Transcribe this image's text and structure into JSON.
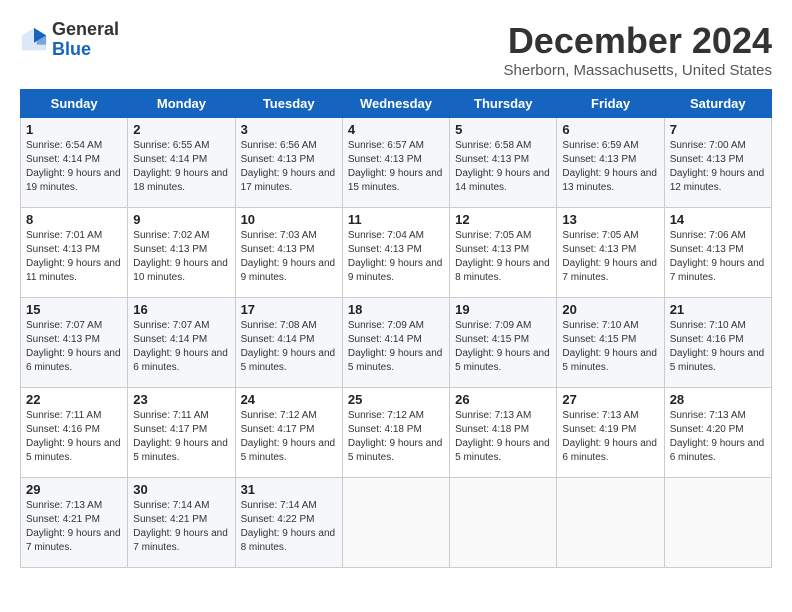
{
  "header": {
    "logo_general": "General",
    "logo_blue": "Blue",
    "title": "December 2024",
    "subtitle": "Sherborn, Massachusetts, United States"
  },
  "weekdays": [
    "Sunday",
    "Monday",
    "Tuesday",
    "Wednesday",
    "Thursday",
    "Friday",
    "Saturday"
  ],
  "weeks": [
    [
      {
        "day": "1",
        "sunrise": "Sunrise: 6:54 AM",
        "sunset": "Sunset: 4:14 PM",
        "daylight": "Daylight: 9 hours and 19 minutes."
      },
      {
        "day": "2",
        "sunrise": "Sunrise: 6:55 AM",
        "sunset": "Sunset: 4:14 PM",
        "daylight": "Daylight: 9 hours and 18 minutes."
      },
      {
        "day": "3",
        "sunrise": "Sunrise: 6:56 AM",
        "sunset": "Sunset: 4:13 PM",
        "daylight": "Daylight: 9 hours and 17 minutes."
      },
      {
        "day": "4",
        "sunrise": "Sunrise: 6:57 AM",
        "sunset": "Sunset: 4:13 PM",
        "daylight": "Daylight: 9 hours and 15 minutes."
      },
      {
        "day": "5",
        "sunrise": "Sunrise: 6:58 AM",
        "sunset": "Sunset: 4:13 PM",
        "daylight": "Daylight: 9 hours and 14 minutes."
      },
      {
        "day": "6",
        "sunrise": "Sunrise: 6:59 AM",
        "sunset": "Sunset: 4:13 PM",
        "daylight": "Daylight: 9 hours and 13 minutes."
      },
      {
        "day": "7",
        "sunrise": "Sunrise: 7:00 AM",
        "sunset": "Sunset: 4:13 PM",
        "daylight": "Daylight: 9 hours and 12 minutes."
      }
    ],
    [
      {
        "day": "8",
        "sunrise": "Sunrise: 7:01 AM",
        "sunset": "Sunset: 4:13 PM",
        "daylight": "Daylight: 9 hours and 11 minutes."
      },
      {
        "day": "9",
        "sunrise": "Sunrise: 7:02 AM",
        "sunset": "Sunset: 4:13 PM",
        "daylight": "Daylight: 9 hours and 10 minutes."
      },
      {
        "day": "10",
        "sunrise": "Sunrise: 7:03 AM",
        "sunset": "Sunset: 4:13 PM",
        "daylight": "Daylight: 9 hours and 9 minutes."
      },
      {
        "day": "11",
        "sunrise": "Sunrise: 7:04 AM",
        "sunset": "Sunset: 4:13 PM",
        "daylight": "Daylight: 9 hours and 9 minutes."
      },
      {
        "day": "12",
        "sunrise": "Sunrise: 7:05 AM",
        "sunset": "Sunset: 4:13 PM",
        "daylight": "Daylight: 9 hours and 8 minutes."
      },
      {
        "day": "13",
        "sunrise": "Sunrise: 7:05 AM",
        "sunset": "Sunset: 4:13 PM",
        "daylight": "Daylight: 9 hours and 7 minutes."
      },
      {
        "day": "14",
        "sunrise": "Sunrise: 7:06 AM",
        "sunset": "Sunset: 4:13 PM",
        "daylight": "Daylight: 9 hours and 7 minutes."
      }
    ],
    [
      {
        "day": "15",
        "sunrise": "Sunrise: 7:07 AM",
        "sunset": "Sunset: 4:13 PM",
        "daylight": "Daylight: 9 hours and 6 minutes."
      },
      {
        "day": "16",
        "sunrise": "Sunrise: 7:07 AM",
        "sunset": "Sunset: 4:14 PM",
        "daylight": "Daylight: 9 hours and 6 minutes."
      },
      {
        "day": "17",
        "sunrise": "Sunrise: 7:08 AM",
        "sunset": "Sunset: 4:14 PM",
        "daylight": "Daylight: 9 hours and 5 minutes."
      },
      {
        "day": "18",
        "sunrise": "Sunrise: 7:09 AM",
        "sunset": "Sunset: 4:14 PM",
        "daylight": "Daylight: 9 hours and 5 minutes."
      },
      {
        "day": "19",
        "sunrise": "Sunrise: 7:09 AM",
        "sunset": "Sunset: 4:15 PM",
        "daylight": "Daylight: 9 hours and 5 minutes."
      },
      {
        "day": "20",
        "sunrise": "Sunrise: 7:10 AM",
        "sunset": "Sunset: 4:15 PM",
        "daylight": "Daylight: 9 hours and 5 minutes."
      },
      {
        "day": "21",
        "sunrise": "Sunrise: 7:10 AM",
        "sunset": "Sunset: 4:16 PM",
        "daylight": "Daylight: 9 hours and 5 minutes."
      }
    ],
    [
      {
        "day": "22",
        "sunrise": "Sunrise: 7:11 AM",
        "sunset": "Sunset: 4:16 PM",
        "daylight": "Daylight: 9 hours and 5 minutes."
      },
      {
        "day": "23",
        "sunrise": "Sunrise: 7:11 AM",
        "sunset": "Sunset: 4:17 PM",
        "daylight": "Daylight: 9 hours and 5 minutes."
      },
      {
        "day": "24",
        "sunrise": "Sunrise: 7:12 AM",
        "sunset": "Sunset: 4:17 PM",
        "daylight": "Daylight: 9 hours and 5 minutes."
      },
      {
        "day": "25",
        "sunrise": "Sunrise: 7:12 AM",
        "sunset": "Sunset: 4:18 PM",
        "daylight": "Daylight: 9 hours and 5 minutes."
      },
      {
        "day": "26",
        "sunrise": "Sunrise: 7:13 AM",
        "sunset": "Sunset: 4:18 PM",
        "daylight": "Daylight: 9 hours and 5 minutes."
      },
      {
        "day": "27",
        "sunrise": "Sunrise: 7:13 AM",
        "sunset": "Sunset: 4:19 PM",
        "daylight": "Daylight: 9 hours and 6 minutes."
      },
      {
        "day": "28",
        "sunrise": "Sunrise: 7:13 AM",
        "sunset": "Sunset: 4:20 PM",
        "daylight": "Daylight: 9 hours and 6 minutes."
      }
    ],
    [
      {
        "day": "29",
        "sunrise": "Sunrise: 7:13 AM",
        "sunset": "Sunset: 4:21 PM",
        "daylight": "Daylight: 9 hours and 7 minutes."
      },
      {
        "day": "30",
        "sunrise": "Sunrise: 7:14 AM",
        "sunset": "Sunset: 4:21 PM",
        "daylight": "Daylight: 9 hours and 7 minutes."
      },
      {
        "day": "31",
        "sunrise": "Sunrise: 7:14 AM",
        "sunset": "Sunset: 4:22 PM",
        "daylight": "Daylight: 9 hours and 8 minutes."
      },
      null,
      null,
      null,
      null
    ]
  ]
}
